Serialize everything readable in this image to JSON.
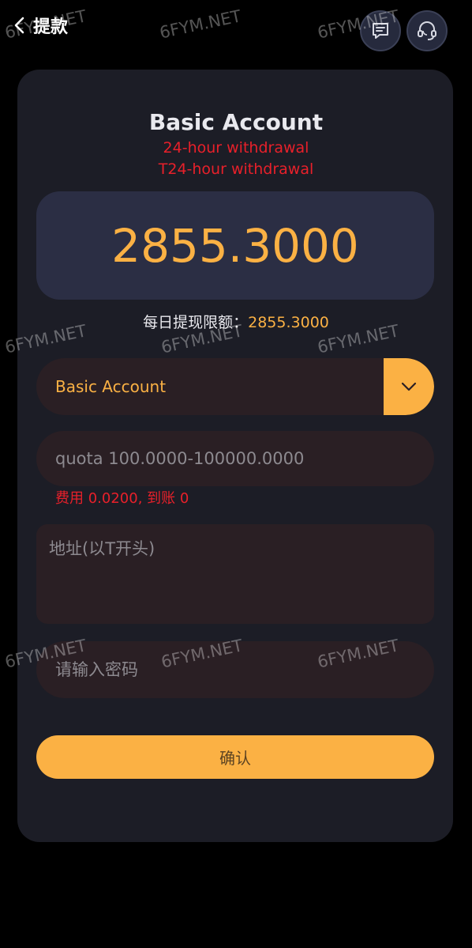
{
  "header": {
    "title": "提款",
    "back_icon": "chevron-left-icon",
    "message_icon": "chat-message-icon",
    "support_icon": "headset-support-icon"
  },
  "account": {
    "title": "Basic Account",
    "note_line1": "24-hour withdrawal",
    "note_line2": "T24-hour withdrawal"
  },
  "balance": {
    "value": "2855.3000"
  },
  "limit": {
    "label": "每日提现限额：",
    "value": "2855.3000"
  },
  "account_select": {
    "selected": "Basic Account",
    "arrow_icon": "chevron-down-icon"
  },
  "form": {
    "quota_placeholder": "quota 100.0000-100000.0000",
    "fee_text": "费用 0.0200, 到账 0",
    "address_placeholder": "地址(以T开头)",
    "password_placeholder": "请输入密码",
    "confirm_label": "确认"
  },
  "watermark": {
    "text": "6FYM.NET"
  },
  "colors": {
    "background": "#000000",
    "card": "#1c1d26",
    "accent": "#fbb144",
    "alert": "#e8202a",
    "field": "#2a1f24",
    "balance_box": "#2b2e44"
  }
}
